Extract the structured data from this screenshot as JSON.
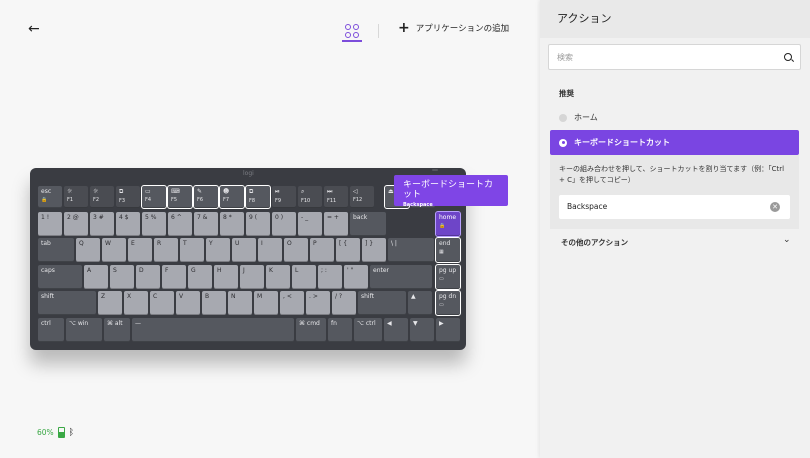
{
  "header": {
    "back_icon": "arrow-left-icon",
    "grid_icon": "grid-icon",
    "add_app_label": "アプリケーションの追加"
  },
  "status": {
    "battery": "60%",
    "bluetooth_icon": "bluetooth-icon"
  },
  "keyboard": {
    "logo": "logi",
    "rows": [
      [
        {
          "l": "esc",
          "s": "🔒"
        },
        {
          "l": "☼",
          "s": "F1"
        },
        {
          "l": "☼",
          "s": "F2"
        },
        {
          "l": "⧉",
          "s": "F3"
        },
        {
          "l": "▭",
          "s": "F4"
        },
        {
          "l": "⌨",
          "s": "F5"
        },
        {
          "l": "✎",
          "s": "F6"
        },
        {
          "l": "☻",
          "s": "F7"
        },
        {
          "l": "⧉",
          "s": "F8"
        },
        {
          "l": "⏯",
          "s": "F9"
        },
        {
          "l": "⌕",
          "s": "F10"
        },
        {
          "l": "⏭",
          "s": "F11"
        },
        {
          "l": "◁",
          "s": "F12"
        },
        {
          "l": "⏏",
          "s": ""
        },
        {
          "l": "↯",
          "s": ""
        }
      ],
      [
        {
          "l": "1 !"
        },
        {
          "l": "2 @"
        },
        {
          "l": "3 #"
        },
        {
          "l": "4 $"
        },
        {
          "l": "5 %"
        },
        {
          "l": "6 ^"
        },
        {
          "l": "7 &"
        },
        {
          "l": "8 *"
        },
        {
          "l": "9 ("
        },
        {
          "l": "0 )"
        },
        {
          "l": "- _"
        },
        {
          "l": "= +"
        },
        {
          "l": "back"
        },
        {
          "l": "home",
          "s": "🔒"
        }
      ],
      [
        {
          "l": "tab"
        },
        {
          "l": "Q"
        },
        {
          "l": "W"
        },
        {
          "l": "E"
        },
        {
          "l": "R"
        },
        {
          "l": "T"
        },
        {
          "l": "Y"
        },
        {
          "l": "U"
        },
        {
          "l": "I"
        },
        {
          "l": "O"
        },
        {
          "l": "P"
        },
        {
          "l": "[ {"
        },
        {
          "l": "] }"
        },
        {
          "l": "\\ |"
        },
        {
          "l": "end",
          "s": "▦"
        }
      ],
      [
        {
          "l": "caps"
        },
        {
          "l": "A"
        },
        {
          "l": "S"
        },
        {
          "l": "D"
        },
        {
          "l": "F"
        },
        {
          "l": "G"
        },
        {
          "l": "H"
        },
        {
          "l": "J"
        },
        {
          "l": "K"
        },
        {
          "l": "L"
        },
        {
          "l": "; :"
        },
        {
          "l": "' \""
        },
        {
          "l": "enter"
        },
        {
          "l": "pg up",
          "s": "▭"
        }
      ],
      [
        {
          "l": "shift"
        },
        {
          "l": "Z"
        },
        {
          "l": "X"
        },
        {
          "l": "C"
        },
        {
          "l": "V"
        },
        {
          "l": "B"
        },
        {
          "l": "N"
        },
        {
          "l": "M"
        },
        {
          "l": ", <"
        },
        {
          "l": ". >"
        },
        {
          "l": "/ ?"
        },
        {
          "l": "shift"
        },
        {
          "l": "▲"
        },
        {
          "l": "pg dn",
          "s": "▭"
        }
      ],
      [
        {
          "l": "ctrl"
        },
        {
          "l": "⌥ win"
        },
        {
          "l": "⌘ alt"
        },
        {
          "l": "—"
        },
        {
          "l": "⌘ cmd"
        },
        {
          "l": "fn"
        },
        {
          "l": "⌥ ctrl"
        },
        {
          "l": "◀"
        },
        {
          "l": "▼"
        },
        {
          "l": "▶"
        }
      ]
    ]
  },
  "tooltip": {
    "title": "キーボードショートカット",
    "key": "Backspace"
  },
  "panel": {
    "title": "アクション",
    "search_placeholder": "検索",
    "search_icon": "search-icon",
    "section_recommended": "推奨",
    "option_home": "ホーム",
    "option_shortcut": "キーボードショートカット",
    "description": "キーの組み合わせを押して、ショートカットを割り当てます（例：「Ctrl + C」を押してコピー）",
    "shortcut_value": "Backspace",
    "clear_icon": "clear-icon",
    "more_actions": "その他のアクション",
    "chevron_icon": "chevron-down-icon"
  },
  "colors": {
    "accent": "#7a45e2",
    "battery": "#3aa845",
    "keyboard_body": "#3a3c42"
  }
}
